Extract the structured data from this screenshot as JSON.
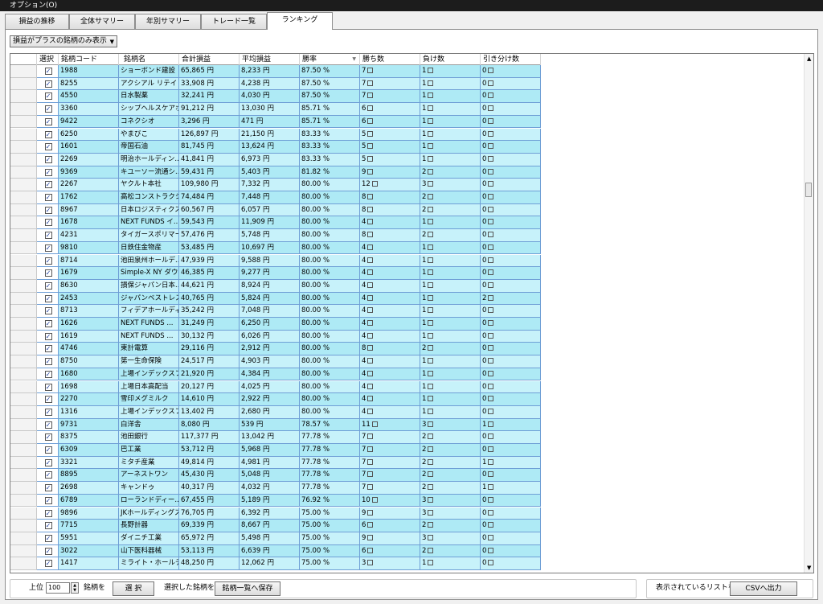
{
  "window": {
    "title": "オプション(O)"
  },
  "tabs": [
    {
      "label": "損益の推移"
    },
    {
      "label": "全体サマリー"
    },
    {
      "label": "年別サマリー"
    },
    {
      "label": "トレード一覧"
    },
    {
      "label": "ランキング",
      "active": true
    }
  ],
  "filter": {
    "selected": "損益がプラスの銘柄のみ表示"
  },
  "columns": [
    "選択",
    "銘柄コード",
    "銘柄名",
    "合計損益",
    "平均損益",
    "勝率",
    "勝ち数",
    "負け数",
    "引き分け数"
  ],
  "sort_column": "勝率",
  "rows": [
    [
      "1988",
      "ショーボンド建設",
      "65,865 円",
      "8,233 円",
      "87.50 %",
      "7",
      "1",
      "0"
    ],
    [
      "8255",
      "アクシアル リテイリ...",
      "33,908 円",
      "4,238 円",
      "87.50 %",
      "7",
      "1",
      "0"
    ],
    [
      "4550",
      "日水製薬",
      "32,241 円",
      "4,030 円",
      "87.50 %",
      "7",
      "1",
      "0"
    ],
    [
      "3360",
      "シップヘルスケアホ...",
      "91,212 円",
      "13,030 円",
      "85.71 %",
      "6",
      "1",
      "0"
    ],
    [
      "9422",
      "コネクシオ",
      "3,296 円",
      "471 円",
      "85.71 %",
      "6",
      "1",
      "0"
    ],
    [
      "6250",
      "やまびこ",
      "126,897 円",
      "21,150 円",
      "83.33 %",
      "5",
      "1",
      "0"
    ],
    [
      "1601",
      "帝国石油",
      "81,745 円",
      "13,624 円",
      "83.33 %",
      "5",
      "1",
      "0"
    ],
    [
      "2269",
      "明治ホールディン...",
      "41,841 円",
      "6,973 円",
      "83.33 %",
      "5",
      "1",
      "0"
    ],
    [
      "9369",
      "キユーソー流通シ...",
      "59,431 円",
      "5,403 円",
      "81.82 %",
      "9",
      "2",
      "0"
    ],
    [
      "2267",
      "ヤクルト本社",
      "109,980 円",
      "7,332 円",
      "80.00 %",
      "12",
      "3",
      "0"
    ],
    [
      "1762",
      "高松コンストラクシ...",
      "74,484 円",
      "7,448 円",
      "80.00 %",
      "8",
      "2",
      "0"
    ],
    [
      "8967",
      "日本ロジスティクス...",
      "60,567 円",
      "6,057 円",
      "80.00 %",
      "8",
      "2",
      "0"
    ],
    [
      "1678",
      "NEXT FUNDS イ...",
      "59,543 円",
      "11,909 円",
      "80.00 %",
      "4",
      "1",
      "0"
    ],
    [
      "4231",
      "タイガースポリマー",
      "57,476 円",
      "5,748 円",
      "80.00 %",
      "8",
      "2",
      "0"
    ],
    [
      "9810",
      "日鉄住金物産",
      "53,485 円",
      "10,697 円",
      "80.00 %",
      "4",
      "1",
      "0"
    ],
    [
      "8714",
      "池田泉州ホールデ...",
      "47,939 円",
      "9,588 円",
      "80.00 %",
      "4",
      "1",
      "0"
    ],
    [
      "1679",
      "Simple-X NY ダウ...",
      "46,385 円",
      "9,277 円",
      "80.00 %",
      "4",
      "1",
      "0"
    ],
    [
      "8630",
      "損保ジャパン日本...",
      "44,621 円",
      "8,924 円",
      "80.00 %",
      "4",
      "1",
      "0"
    ],
    [
      "2453",
      "ジャパンベストレス...",
      "40,765 円",
      "5,824 円",
      "80.00 %",
      "4",
      "1",
      "2"
    ],
    [
      "8713",
      "フィデアホールディ...",
      "35,242 円",
      "7,048 円",
      "80.00 %",
      "4",
      "1",
      "0"
    ],
    [
      "1626",
      "NEXT FUNDS ...",
      "31,249 円",
      "6,250 円",
      "80.00 %",
      "4",
      "1",
      "0"
    ],
    [
      "1619",
      "NEXT FUNDS ...",
      "30,132 円",
      "6,026 円",
      "80.00 %",
      "4",
      "1",
      "0"
    ],
    [
      "4746",
      "東計電算",
      "29,116 円",
      "2,912 円",
      "80.00 %",
      "8",
      "2",
      "0"
    ],
    [
      "8750",
      "第一生命保険",
      "24,517 円",
      "4,903 円",
      "80.00 %",
      "4",
      "1",
      "0"
    ],
    [
      "1680",
      "上場インデックスフ...",
      "21,920 円",
      "4,384 円",
      "80.00 %",
      "4",
      "1",
      "0"
    ],
    [
      "1698",
      "上場日本高配当",
      "20,127 円",
      "4,025 円",
      "80.00 %",
      "4",
      "1",
      "0"
    ],
    [
      "2270",
      "雪印メグミルク",
      "14,610 円",
      "2,922 円",
      "80.00 %",
      "4",
      "1",
      "0"
    ],
    [
      "1316",
      "上場インデックスフ...",
      "13,402 円",
      "2,680 円",
      "80.00 %",
      "4",
      "1",
      "0"
    ],
    [
      "9731",
      "白洋舎",
      "8,080 円",
      "539 円",
      "78.57 %",
      "11",
      "3",
      "1"
    ],
    [
      "8375",
      "池田銀行",
      "117,377 円",
      "13,042 円",
      "77.78 %",
      "7",
      "2",
      "0"
    ],
    [
      "6309",
      "巴工業",
      "53,712 円",
      "5,968 円",
      "77.78 %",
      "7",
      "2",
      "0"
    ],
    [
      "3321",
      "ミタチ産業",
      "49,814 円",
      "4,981 円",
      "77.78 %",
      "7",
      "2",
      "1"
    ],
    [
      "8895",
      "アーネストワン",
      "45,430 円",
      "5,048 円",
      "77.78 %",
      "7",
      "2",
      "0"
    ],
    [
      "2698",
      "キャンドゥ",
      "40,317 円",
      "4,032 円",
      "77.78 %",
      "7",
      "2",
      "1"
    ],
    [
      "6789",
      "ローランドディー...",
      "67,455 円",
      "5,189 円",
      "76.92 %",
      "10",
      "3",
      "0"
    ],
    [
      "9896",
      "JKホールディングス",
      "76,705 円",
      "6,392 円",
      "75.00 %",
      "9",
      "3",
      "0"
    ],
    [
      "7715",
      "長野計器",
      "69,339 円",
      "8,667 円",
      "75.00 %",
      "6",
      "2",
      "0"
    ],
    [
      "5951",
      "ダイニチ工業",
      "65,972 円",
      "5,498 円",
      "75.00 %",
      "9",
      "3",
      "0"
    ],
    [
      "3022",
      "山下医科器械",
      "53,113 円",
      "6,639 円",
      "75.00 %",
      "6",
      "2",
      "0"
    ],
    [
      "1417",
      "ミライト・ホールディ...",
      "48,250 円",
      "12,062 円",
      "75.00 %",
      "3",
      "1",
      "0"
    ]
  ],
  "bottom": {
    "top_label": "上位",
    "top_value": "100",
    "stocks_label": "銘柄を",
    "select_button": "選 択",
    "selected_label": "選択した銘柄を",
    "save_button": "銘柄一覧へ保存",
    "list_label": "表示されているリストを",
    "csv_button": "CSVへ出力"
  }
}
